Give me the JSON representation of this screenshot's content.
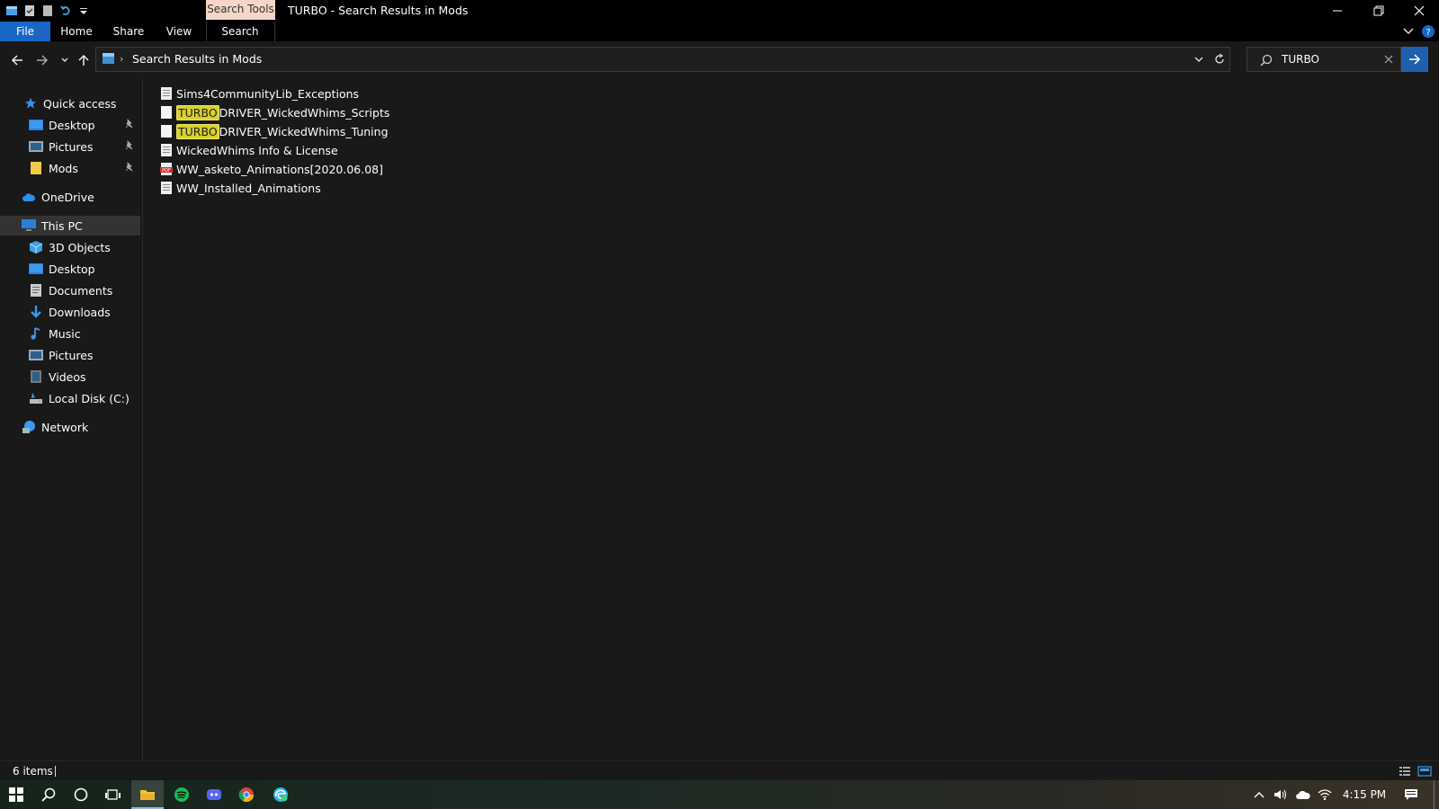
{
  "titlebar": {
    "context_tab": "Search Tools",
    "title": "TURBO - Search Results in Mods"
  },
  "ribbon": {
    "tabs": [
      "File",
      "Home",
      "Share",
      "View",
      "Search"
    ]
  },
  "address": {
    "path": "Search Results in Mods"
  },
  "search": {
    "value": "TURBO"
  },
  "nav": {
    "quick_access": "Quick access",
    "quick_items": [
      "Desktop",
      "Pictures",
      "Mods"
    ],
    "onedrive": "OneDrive",
    "this_pc": "This PC",
    "pc_items": [
      "3D Objects",
      "Desktop",
      "Documents",
      "Downloads",
      "Music",
      "Pictures",
      "Videos",
      "Local Disk (C:)"
    ],
    "network": "Network"
  },
  "files": [
    {
      "highlight": "",
      "rest": "Sims4CommunityLib_Exceptions",
      "type": "text-file"
    },
    {
      "highlight": "TURBO",
      "rest": "DRIVER_WickedWhims_Scripts",
      "type": "blank-file"
    },
    {
      "highlight": "TURBO",
      "rest": "DRIVER_WickedWhims_Tuning",
      "type": "blank-file"
    },
    {
      "highlight": "",
      "rest": "WickedWhims Info & License",
      "type": "text-file"
    },
    {
      "highlight": "",
      "rest": "WW_asketo_Animations[2020.06.08]",
      "type": "pdf-file"
    },
    {
      "highlight": "",
      "rest": "WW_Installed_Animations",
      "type": "text-file"
    }
  ],
  "status": {
    "item_count": "6 items"
  },
  "taskbar": {
    "clock": "4:15 PM"
  },
  "colors": {
    "accent": "#1a66c4",
    "highlight": "#d7d12b",
    "context_tab": "#f5d6c9"
  }
}
